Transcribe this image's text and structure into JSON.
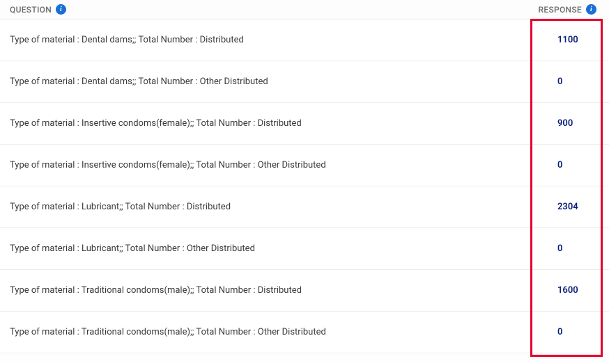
{
  "header": {
    "question_label": "QUESTION",
    "response_label": "RESPONSE"
  },
  "rows": [
    {
      "question": "Type of material : Dental dams;; Total Number : Distributed",
      "response": "1100"
    },
    {
      "question": "Type of material : Dental dams;; Total Number : Other Distributed",
      "response": "0"
    },
    {
      "question": "Type of material : Insertive condoms(female);; Total Number : Distributed",
      "response": "900"
    },
    {
      "question": "Type of material : Insertive condoms(female);; Total Number : Other Distributed",
      "response": "0"
    },
    {
      "question": "Type of material : Lubricant;; Total Number : Distributed",
      "response": "2304"
    },
    {
      "question": "Type of material : Lubricant;; Total Number : Other Distributed",
      "response": "0"
    },
    {
      "question": "Type of material : Traditional condoms(male);; Total Number : Distributed",
      "response": "1600"
    },
    {
      "question": "Type of material : Traditional condoms(male);; Total Number : Other Distributed",
      "response": "0"
    }
  ],
  "highlight": {
    "color": "#e4002b"
  }
}
